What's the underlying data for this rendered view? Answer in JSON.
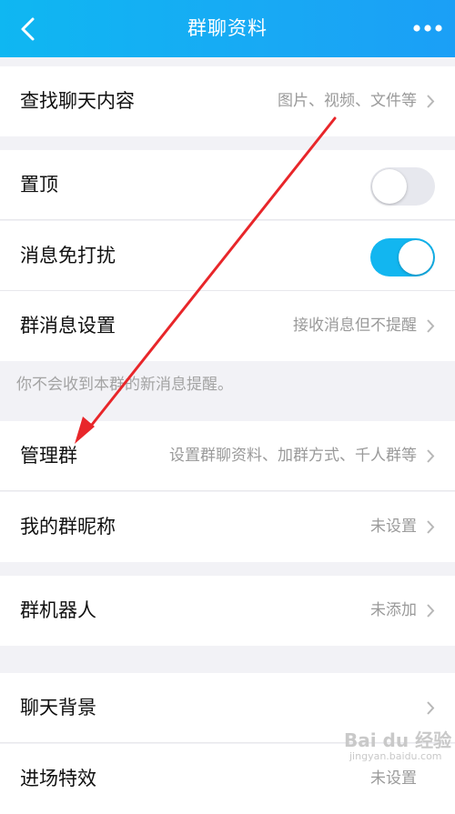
{
  "header": {
    "title": "群聊资料",
    "back_icon": "chevron-left-icon",
    "more_icon": "more-dots-icon",
    "background_color": "#14b0f4"
  },
  "rows": {
    "search_chat": {
      "label": "查找聊天内容",
      "value": "图片、视频、文件等"
    },
    "pin_top": {
      "label": "置顶",
      "toggle": "off"
    },
    "do_not_disturb": {
      "label": "消息免打扰",
      "toggle": "on"
    },
    "group_message_settings": {
      "label": "群消息设置",
      "value": "接收消息但不提醒"
    },
    "manage_group": {
      "label": "管理群",
      "value": "设置群聊资料、加群方式、千人群等"
    },
    "my_nickname": {
      "label": "我的群昵称",
      "value": "未设置"
    },
    "group_robot": {
      "label": "群机器人",
      "value": "未添加"
    },
    "chat_background": {
      "label": "聊天背景",
      "value": ""
    },
    "special_effects": {
      "label": "进场特效",
      "value": "未设置"
    }
  },
  "hint_text": "你不会收到本群的新消息提醒。",
  "watermark": {
    "main": "Bai du 经验",
    "sub": "jingyan.baidu.com"
  },
  "colors": {
    "accent": "#12b6f0",
    "annotation_arrow": "#e8262a",
    "page_background": "#f2f2f6"
  }
}
